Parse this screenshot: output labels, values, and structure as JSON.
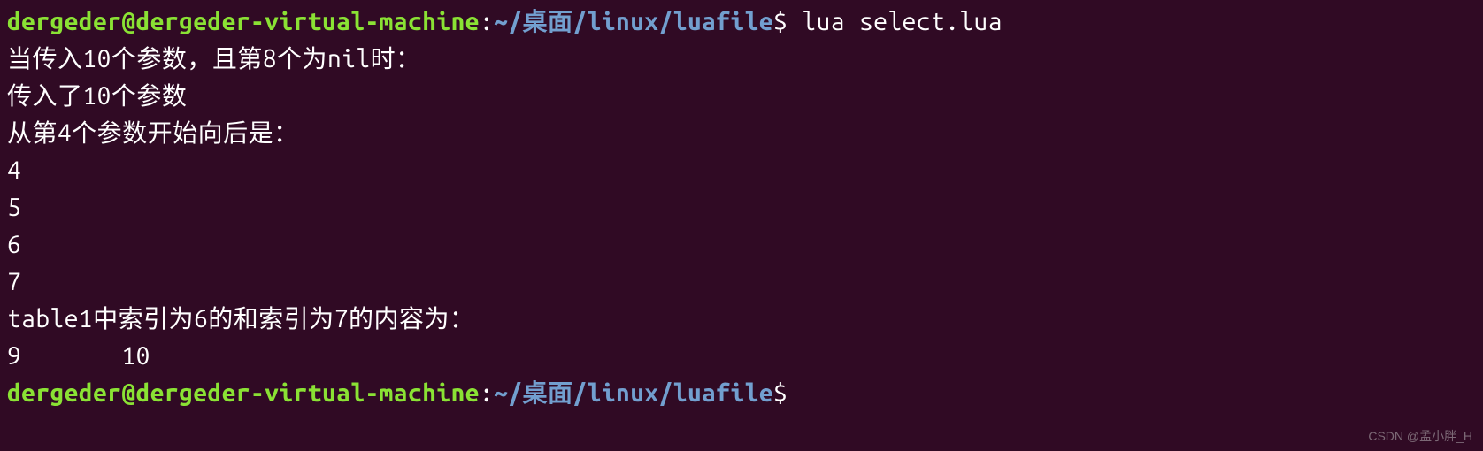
{
  "prompt1": {
    "user": "dergeder@dergeder-virtual-machine",
    "colon": ":",
    "path": "~/桌面/linux/luafile",
    "dollar": "$",
    "command": " lua select.lua"
  },
  "output": {
    "line1": "当传入10个参数，且第8个为nil时：",
    "line2": "传入了10个参数",
    "line3": "从第4个参数开始向后是：",
    "line4": "4",
    "line5": "5",
    "line6": "6",
    "line7": "7",
    "line8": "table1中索引为6的和索引为7的内容为：",
    "line9": "9       10"
  },
  "prompt2": {
    "user": "dergeder@dergeder-virtual-machine",
    "colon": ":",
    "path": "~/桌面/linux/luafile",
    "dollar": "$"
  },
  "watermark": "CSDN @孟小胖_H"
}
